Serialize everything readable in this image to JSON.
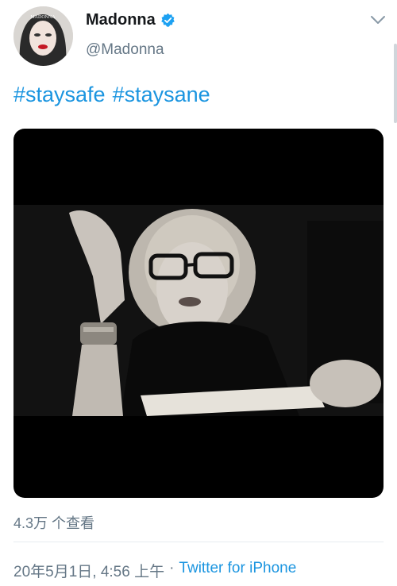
{
  "author": {
    "display_name": "Madonna",
    "handle": "@Madonna",
    "avatar_text": "MADONNA",
    "verified_icon": "verified-badge-icon"
  },
  "tweet": {
    "hashtags": [
      "#staysafe",
      "#staysane"
    ]
  },
  "media": {
    "type": "video",
    "description_icon": "video-thumbnail"
  },
  "stats": {
    "views": "4.3万 个查看"
  },
  "meta": {
    "timestamp": "20年5月1日, 4:56 上午",
    "separator": "·",
    "source": "Twitter for iPhone"
  },
  "colors": {
    "link": "#1b95e0",
    "muted": "#657786",
    "text": "#14171a",
    "verified": "#1da1f2"
  }
}
